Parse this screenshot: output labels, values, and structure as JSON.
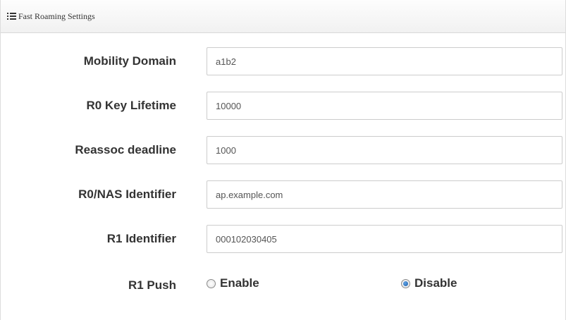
{
  "header": {
    "title": "Fast Roaming Settings",
    "icon": "list-icon"
  },
  "fields": [
    {
      "label": "Mobility Domain",
      "value": "a1b2"
    },
    {
      "label": "R0 Key Lifetime",
      "value": "10000"
    },
    {
      "label": "Reassoc deadline",
      "value": "1000"
    },
    {
      "label": "R0/NAS Identifier",
      "value": "ap.example.com"
    },
    {
      "label": "R1 Identifier",
      "value": "000102030405"
    }
  ],
  "r1_push": {
    "label": "R1 Push",
    "options": [
      {
        "label": "Enable",
        "checked": false
      },
      {
        "label": "Disable",
        "checked": true
      }
    ]
  },
  "colors": {
    "radio_selected": "#1d5fa8",
    "label_text": "#333333",
    "input_border": "#cccccc"
  }
}
